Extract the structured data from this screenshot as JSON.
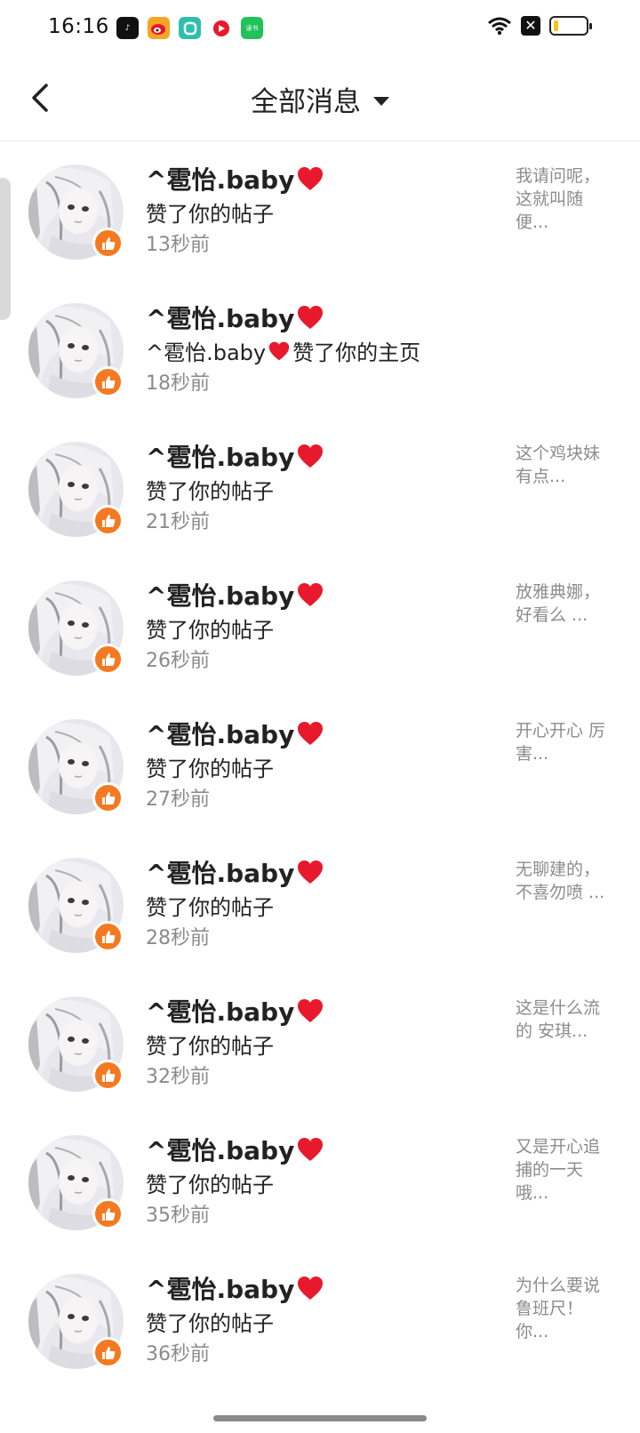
{
  "status_bar": {
    "time": "16:16",
    "apps": [
      {
        "name": "tiktok-icon",
        "glyph": "♪"
      },
      {
        "name": "weibo-icon",
        "glyph": "◉"
      },
      {
        "name": "teal-app-icon",
        "glyph": "◎"
      },
      {
        "name": "red-app-icon",
        "glyph": "●"
      },
      {
        "name": "green-app-icon",
        "glyph": "读书"
      }
    ],
    "battery_level": 0.15
  },
  "header": {
    "title": "全部消息"
  },
  "colors": {
    "like_badge": "#f47920",
    "heart": "#e8192c",
    "muted_text": "#8a8a8a"
  },
  "messages": [
    {
      "name": "^雹怡.baby",
      "action": "赞了你的帖子",
      "time": "13秒前",
      "preview": "我请问呢，这就叫随便..."
    },
    {
      "name": "^雹怡.baby",
      "action_prefix": "^雹怡.baby",
      "action": "赞了你的主页",
      "time": "18秒前",
      "preview": ""
    },
    {
      "name": "^雹怡.baby",
      "action": "赞了你的帖子",
      "time": "21秒前",
      "preview": "这个鸡块妹有点..."
    },
    {
      "name": "^雹怡.baby",
      "action": "赞了你的帖子",
      "time": "26秒前",
      "preview": "放雅典娜，好看么 ..."
    },
    {
      "name": "^雹怡.baby",
      "action": "赞了你的帖子",
      "time": "27秒前",
      "preview": "开心开心 厉害..."
    },
    {
      "name": "^雹怡.baby",
      "action": "赞了你的帖子",
      "time": "28秒前",
      "preview": "无聊建的，不喜勿喷 ..."
    },
    {
      "name": "^雹怡.baby",
      "action": "赞了你的帖子",
      "time": "32秒前",
      "preview": "这是什么流的 安琪..."
    },
    {
      "name": "^雹怡.baby",
      "action": "赞了你的帖子",
      "time": "35秒前",
      "preview": "又是开心追捕的一天哦..."
    },
    {
      "name": "^雹怡.baby",
      "action": "赞了你的帖子",
      "time": "36秒前",
      "preview": "为什么要说鲁班尺！你..."
    }
  ]
}
